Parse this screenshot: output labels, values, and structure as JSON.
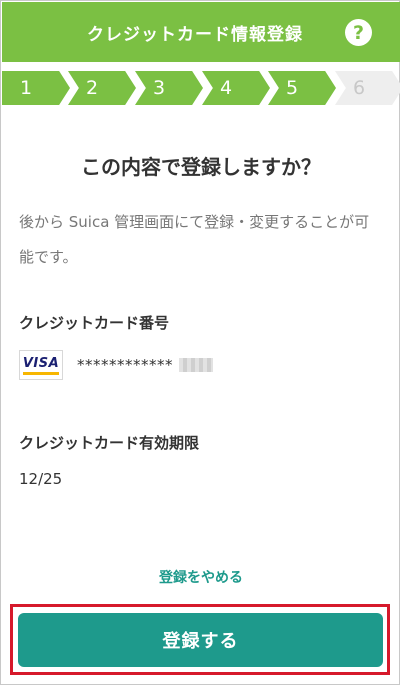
{
  "header": {
    "title": "クレジットカード情報登録",
    "help_label": "?"
  },
  "steps": [
    {
      "label": "1",
      "state": "done"
    },
    {
      "label": "2",
      "state": "done"
    },
    {
      "label": "3",
      "state": "done"
    },
    {
      "label": "4",
      "state": "done"
    },
    {
      "label": "5",
      "state": "done"
    },
    {
      "label": "6",
      "state": "todo"
    }
  ],
  "main": {
    "title": "この内容で登録しますか？",
    "description": "後から Suica 管理画面にて登録・変更することが可能です。",
    "card_number_label": "クレジットカード番号",
    "card_brand": "VISA",
    "card_number_masked": "************",
    "expiry_label": "クレジットカード有効期限",
    "expiry_value": "12/25"
  },
  "actions": {
    "cancel_label": "登録をやめる",
    "submit_label": "登録する"
  },
  "colors": {
    "brand_green": "#7bc043",
    "action_teal": "#1e9a8c",
    "highlight_red": "#d6192b"
  }
}
